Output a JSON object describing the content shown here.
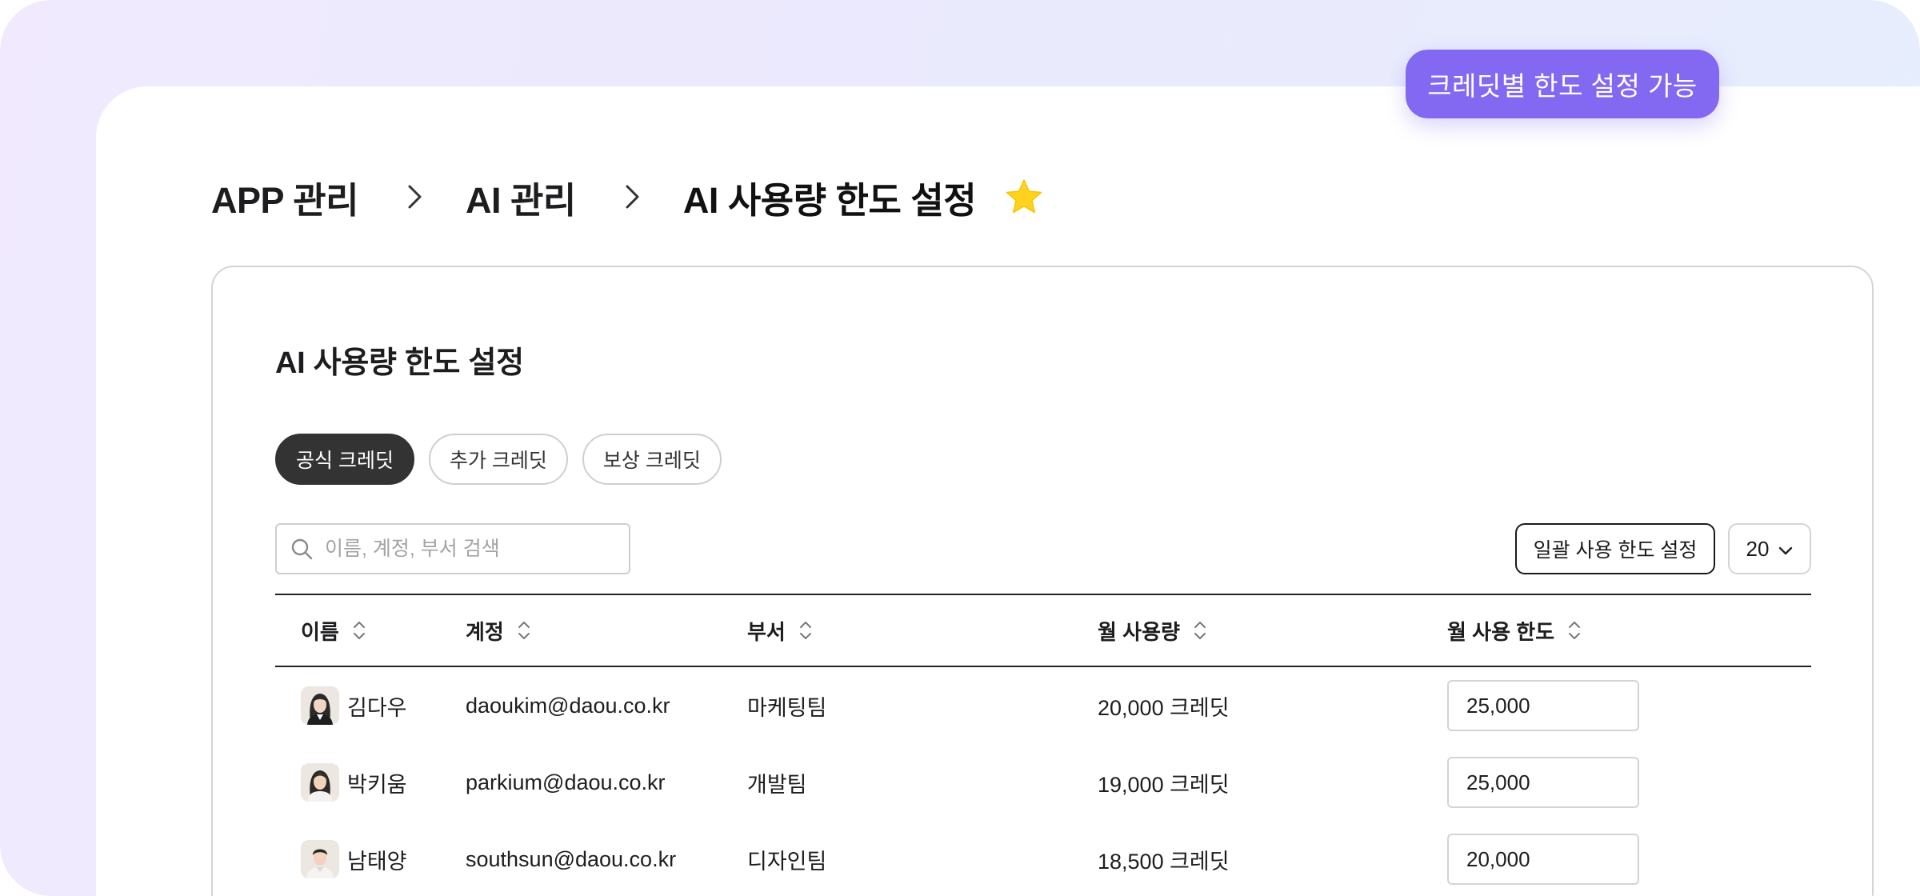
{
  "promo": {
    "label": "크레딧별 한도 설정 가능"
  },
  "breadcrumb": [
    {
      "label": "APP 관리"
    },
    {
      "label": "AI 관리"
    },
    {
      "label": "AI 사용량 한도 설정"
    }
  ],
  "card": {
    "title": "AI 사용량 한도 설정",
    "tabs": [
      {
        "label": "공식 크레딧",
        "active": true
      },
      {
        "label": "추가 크레딧",
        "active": false
      },
      {
        "label": "보상 크레딧",
        "active": false
      }
    ],
    "search": {
      "placeholder": "이름, 계정, 부서 검색",
      "value": ""
    },
    "bulk_button": "일괄 사용 한도 설정",
    "page_size": {
      "selected": "20"
    },
    "table": {
      "columns": [
        "이름",
        "계정",
        "부서",
        "월 사용량",
        "월 사용 한도"
      ],
      "rows": [
        {
          "name": "김다우",
          "account": "daoukim@daou.co.kr",
          "dept": "마케팅팀",
          "usage": "20,000 크레딧",
          "limit": "25,000",
          "avatar": "female"
        },
        {
          "name": "박키움",
          "account": "parkium@daou.co.kr",
          "dept": "개발팀",
          "usage": "19,000 크레딧",
          "limit": "25,000",
          "avatar": "female"
        },
        {
          "name": "남태양",
          "account": "southsun@daou.co.kr",
          "dept": "디자인팀",
          "usage": "18,500 크레딧",
          "limit": "20,000",
          "avatar": "male"
        }
      ]
    }
  },
  "colors": {
    "accent": "#8368f2",
    "active_tab": "#333333",
    "star": "#ffd21f"
  },
  "icons": {
    "favorite": "star-icon",
    "breadcrumb_separator": "chevron-right-icon",
    "search": "search-icon",
    "sort": "sort-icon",
    "dropdown": "chevron-down-icon"
  }
}
